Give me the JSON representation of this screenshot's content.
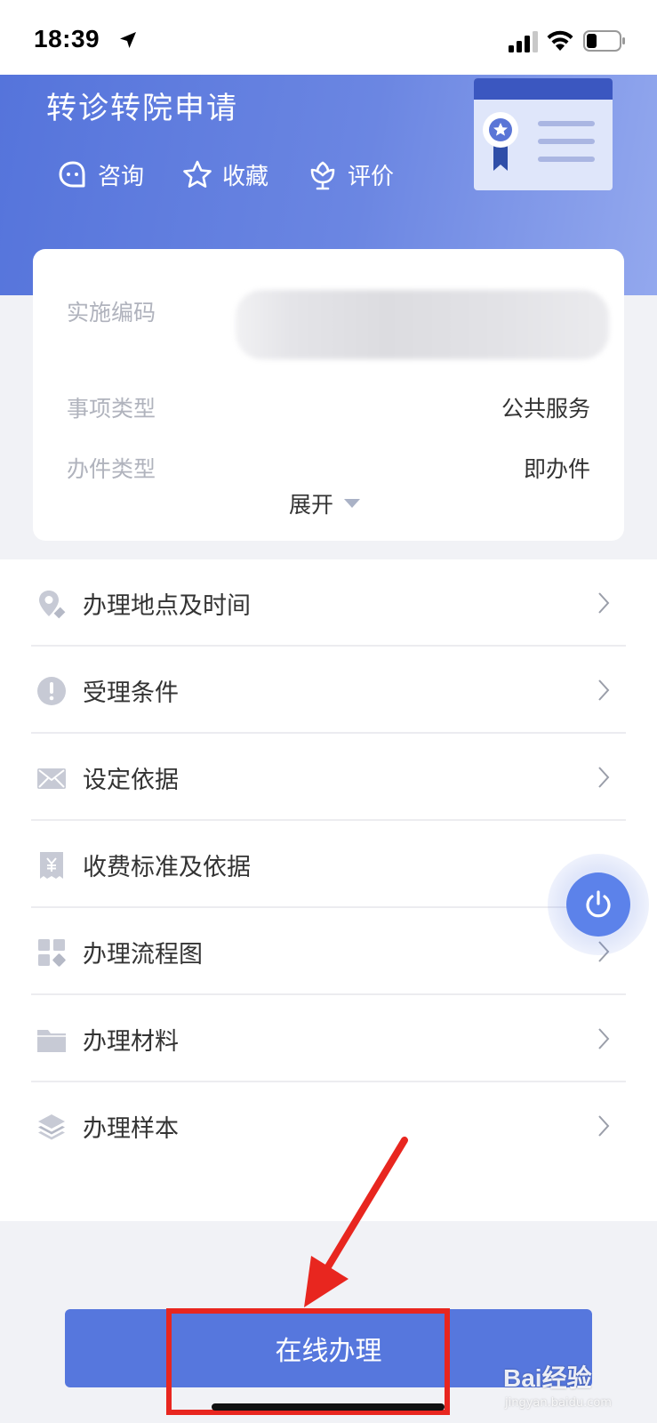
{
  "status_bar": {
    "time": "18:39"
  },
  "header": {
    "title": "转诊转院申请",
    "actions": [
      {
        "label": "咨询",
        "icon": "chat-icon"
      },
      {
        "label": "收藏",
        "icon": "star-icon"
      },
      {
        "label": "评价",
        "icon": "flower-icon"
      }
    ]
  },
  "info": {
    "rows": [
      {
        "label": "实施编码",
        "value": ""
      },
      {
        "label": "事项类型",
        "value": "公共服务"
      },
      {
        "label": "办件类型",
        "value": "即办件"
      }
    ],
    "expand_label": "展开"
  },
  "menu": {
    "items": [
      {
        "label": "办理地点及时间",
        "icon": "location-icon"
      },
      {
        "label": "受理条件",
        "icon": "exclamation-icon"
      },
      {
        "label": "设定依据",
        "icon": "envelope-icon"
      },
      {
        "label": "收费标准及依据",
        "icon": "yen-receipt-icon"
      },
      {
        "label": "办理流程图",
        "icon": "grid-icon"
      },
      {
        "label": "办理材料",
        "icon": "folder-icon"
      },
      {
        "label": "办理样本",
        "icon": "layers-icon"
      }
    ]
  },
  "primary_action": {
    "label": "在线办理"
  },
  "watermark": {
    "brand": "Bai经验",
    "sub": "jingyan.baidu.com"
  },
  "colors": {
    "primary": "#5677dd",
    "annotation": "#e8261f",
    "hero_start": "#5574db",
    "hero_end": "#93a8ee"
  }
}
